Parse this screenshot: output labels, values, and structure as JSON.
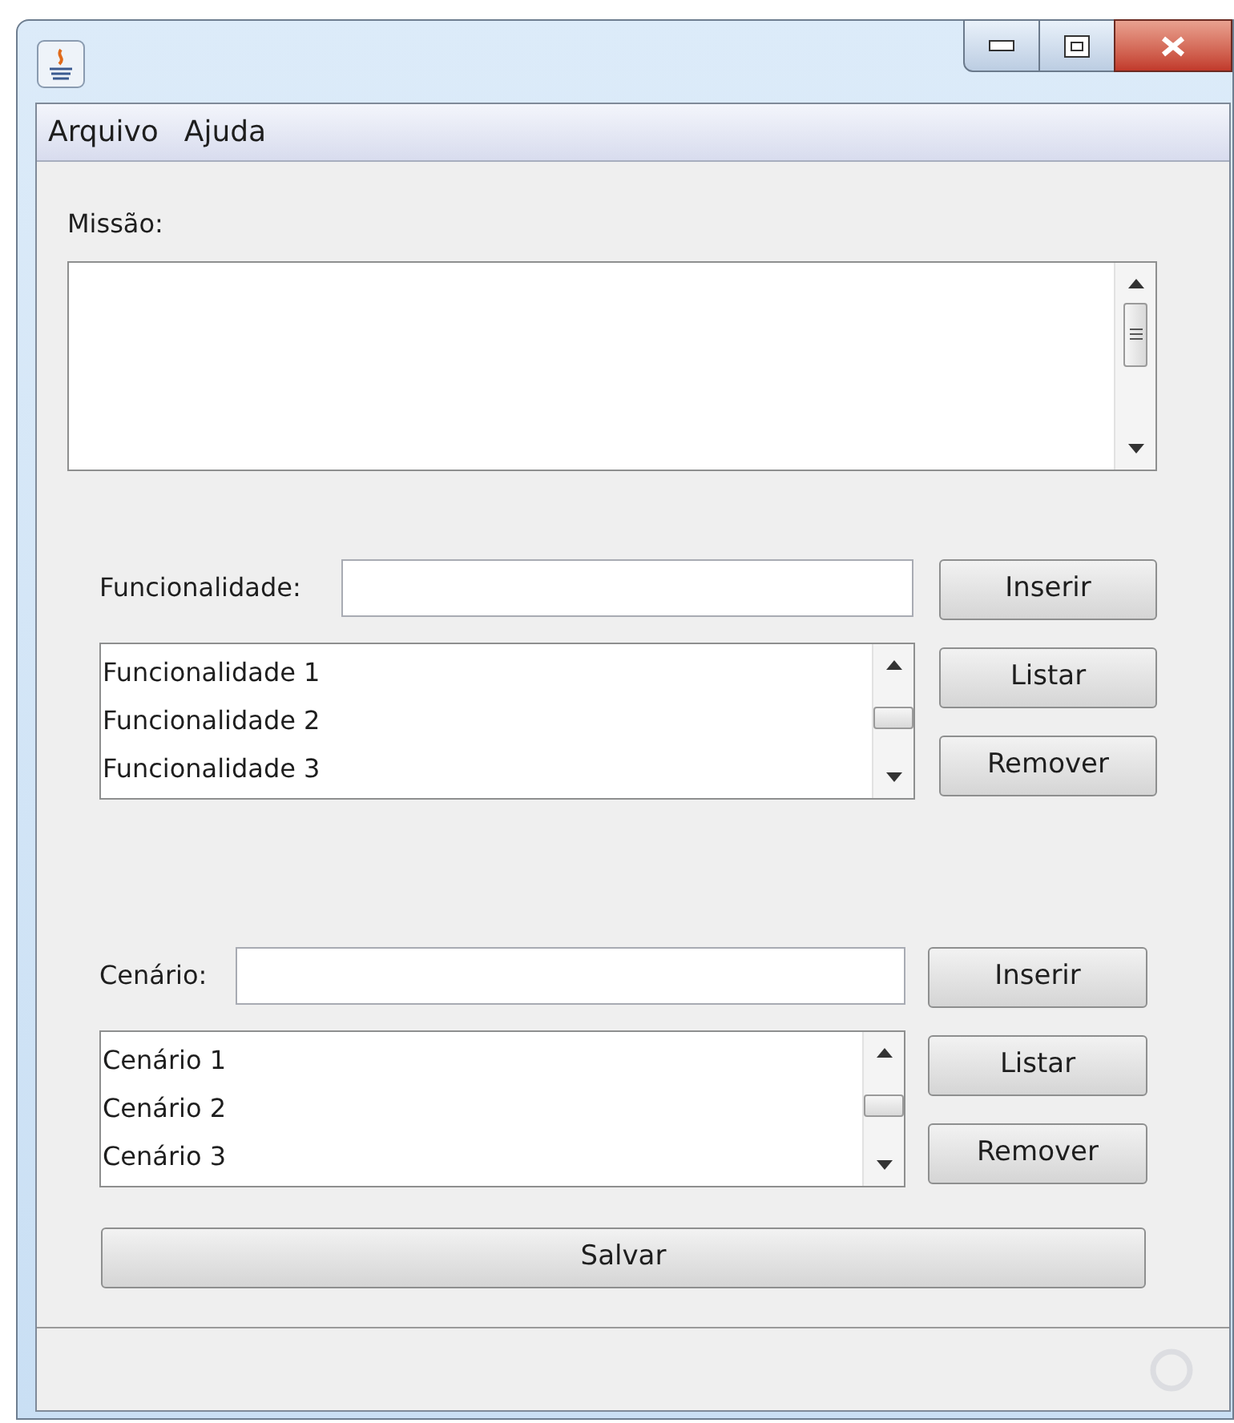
{
  "menu": [
    "Arquivo",
    "Ajuda"
  ],
  "mission": {
    "label": "Missão:"
  },
  "sections": [
    {
      "label": "Funcionalidade:",
      "items": [
        "Funcionalidade 1",
        "Funcionalidade 2",
        "Funcionalidade 3"
      ],
      "buttons": [
        "Inserir",
        "Listar",
        "Remover"
      ]
    },
    {
      "label": "Cenário:",
      "items": [
        "Cenário 1",
        "Cenário 2",
        "Cenário 3"
      ],
      "buttons": [
        "Inserir",
        "Listar",
        "Remover"
      ]
    }
  ],
  "save_button": "Salvar"
}
